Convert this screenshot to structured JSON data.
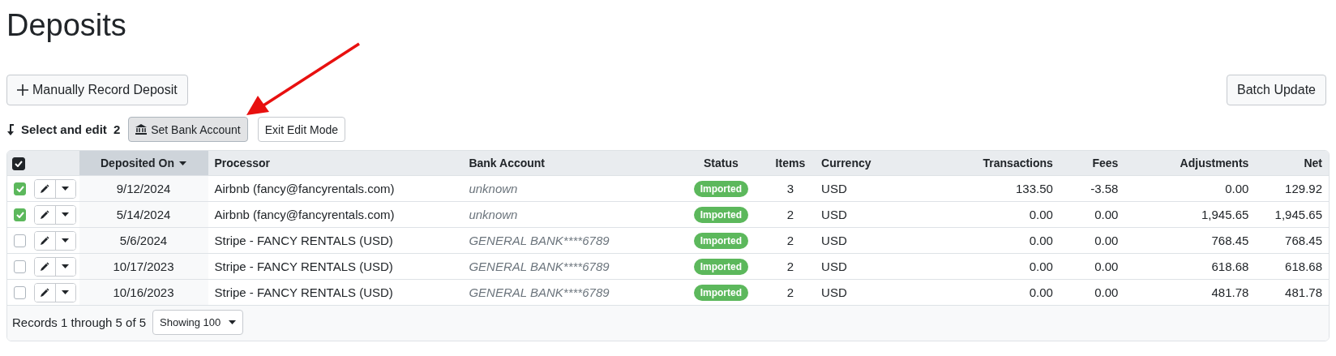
{
  "title": "Deposits",
  "toolbar": {
    "record_button": "Manually Record Deposit",
    "batch_button": "Batch Update"
  },
  "edit_bar": {
    "label": "Select and edit",
    "count": "2",
    "set_bank_button": "Set Bank Account",
    "set_bank_pressed": true,
    "exit_button": "Exit Edit Mode"
  },
  "table": {
    "select_all_checked": true,
    "columns": [
      {
        "label": "Deposited On",
        "sorted": true
      },
      {
        "label": "Processor",
        "sorted": false
      },
      {
        "label": "Bank Account",
        "sorted": false
      },
      {
        "label": "Status",
        "sorted": false
      },
      {
        "label": "Items",
        "sorted": false
      },
      {
        "label": "Currency",
        "sorted": false
      },
      {
        "label": "Transactions",
        "sorted": false
      },
      {
        "label": "Fees",
        "sorted": false
      },
      {
        "label": "Adjustments",
        "sorted": false
      },
      {
        "label": "Net",
        "sorted": false
      }
    ],
    "rows": [
      {
        "checked": true,
        "date": "9/12/2024",
        "processor": "Airbnb (fancy@fancyrentals.com)",
        "bank_account": "unknown",
        "status": "Imported",
        "items": "3",
        "currency": "USD",
        "transactions": "133.50",
        "fees": "-3.58",
        "adjustments": "0.00",
        "net": "129.92"
      },
      {
        "checked": true,
        "date": "5/14/2024",
        "processor": "Airbnb (fancy@fancyrentals.com)",
        "bank_account": "unknown",
        "status": "Imported",
        "items": "2",
        "currency": "USD",
        "transactions": "0.00",
        "fees": "0.00",
        "adjustments": "1,945.65",
        "net": "1,945.65"
      },
      {
        "checked": false,
        "date": "5/6/2024",
        "processor": "Stripe - FANCY RENTALS (USD)",
        "bank_account": "GENERAL BANK****6789",
        "status": "Imported",
        "items": "2",
        "currency": "USD",
        "transactions": "0.00",
        "fees": "0.00",
        "adjustments": "768.45",
        "net": "768.45"
      },
      {
        "checked": false,
        "date": "10/17/2023",
        "processor": "Stripe - FANCY RENTALS (USD)",
        "bank_account": "GENERAL BANK****6789",
        "status": "Imported",
        "items": "2",
        "currency": "USD",
        "transactions": "0.00",
        "fees": "0.00",
        "adjustments": "618.68",
        "net": "618.68"
      },
      {
        "checked": false,
        "date": "10/16/2023",
        "processor": "Stripe - FANCY RENTALS (USD)",
        "bank_account": "GENERAL BANK****6789",
        "status": "Imported",
        "items": "2",
        "currency": "USD",
        "transactions": "0.00",
        "fees": "0.00",
        "adjustments": "481.78",
        "net": "481.78"
      }
    ],
    "footer": {
      "records": "Records 1 through 5 of 5",
      "page_size": "Showing 100"
    }
  }
}
